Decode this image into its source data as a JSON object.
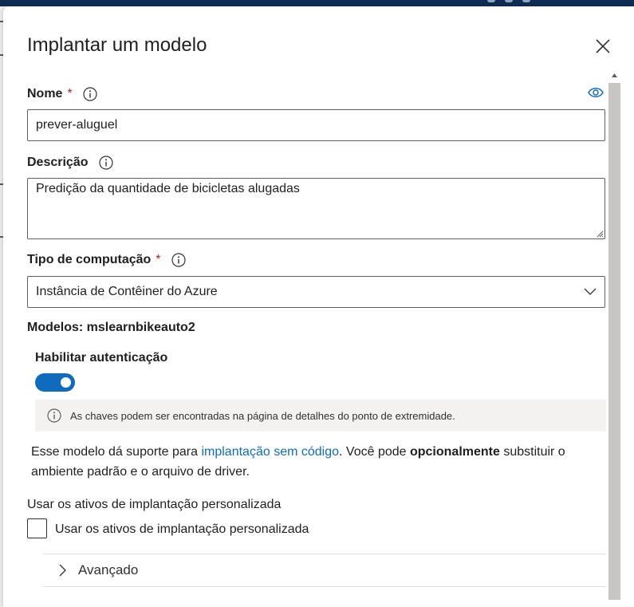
{
  "dialog": {
    "title": "Implantar um modelo",
    "close_icon": "close-icon"
  },
  "name": {
    "label": "Nome",
    "required_mark": "*",
    "value": "prever-aluguel",
    "info_icon": "info-icon",
    "visibility_icon": "eye-icon"
  },
  "description": {
    "label": "Descrição",
    "value": "Predição da quantidade de bicicletas alugadas",
    "info_icon": "info-icon"
  },
  "compute": {
    "label": "Tipo de computação",
    "required_mark": "*",
    "selected": "Instância de Contêiner do Azure",
    "info_icon": "info-icon",
    "chevron_icon": "chevron-down-icon"
  },
  "models_line": "Modelos: mslearnbikeauto2",
  "auth": {
    "label": "Habilitar autenticação",
    "enabled": true
  },
  "info_message": "As chaves podem ser encontradas na página de detalhes do ponto de extremidade.",
  "support_text": {
    "part1": "Esse modelo dá suporte para ",
    "link": "implantação sem código",
    "part2": ". Você pode ",
    "bold": "opcionalmente",
    "part3": " substituir o ambiente padrão e o arquivo de driver."
  },
  "custom_assets": {
    "heading": "Usar os ativos de implantação personalizada",
    "checkbox_label": "Usar os ativos de implantação personalizada",
    "checked": false
  },
  "advanced": {
    "label": "Avançado",
    "chevron_icon": "chevron-right-icon"
  },
  "colors": {
    "accent": "#0f6cbd",
    "required": "#a4262c",
    "info_bar": "#f3f2f1"
  }
}
